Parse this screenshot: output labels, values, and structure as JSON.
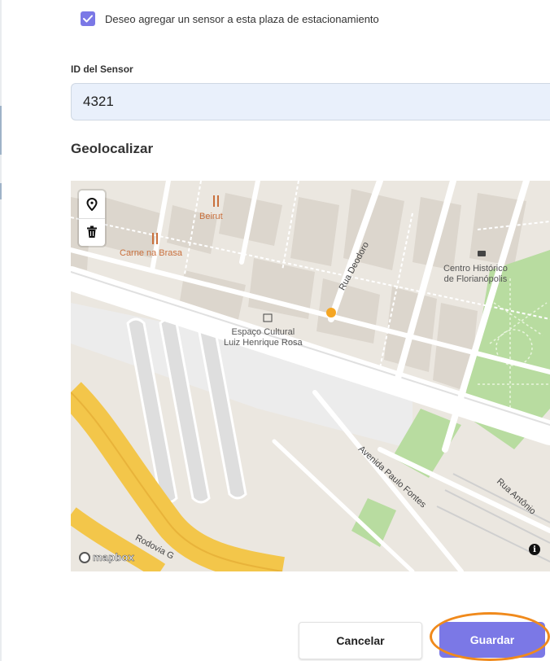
{
  "form": {
    "sensor_checkbox_label": "Deseo agregar un sensor a esta plaza de estacionamiento",
    "sensor_checked": true,
    "sensor_id_label": "ID del Sensor",
    "sensor_id_value": "4321",
    "geolocate_title": "Geolocalizar"
  },
  "map": {
    "tools": [
      "map-pin-icon",
      "trash-icon"
    ],
    "places": {
      "beirut": "Beirut",
      "carne_na_brasa": "Carne na Brasa",
      "centro_historico_1": "Centro Histórico",
      "centro_historico_2": "de Florianópolis",
      "espaco_cultural_1": "Espaço Cultural",
      "espaco_cultural_2": "Luiz Henrique Rosa"
    },
    "streets": {
      "rua_deodoro": "Rua Deodoro",
      "avenida_paulo_fontes": "Avenida Paulo Fontes",
      "rua_antonio": "Rua Antônio",
      "rodovia": "Rodovia G"
    },
    "attribution": "mapbox",
    "info_glyph": "i",
    "marker_color": "#f5a623"
  },
  "actions": {
    "cancel_label": "Cancelar",
    "save_label": "Guardar"
  },
  "colors": {
    "accent": "#7b78e6",
    "highlight_ring": "#f08a1c"
  }
}
